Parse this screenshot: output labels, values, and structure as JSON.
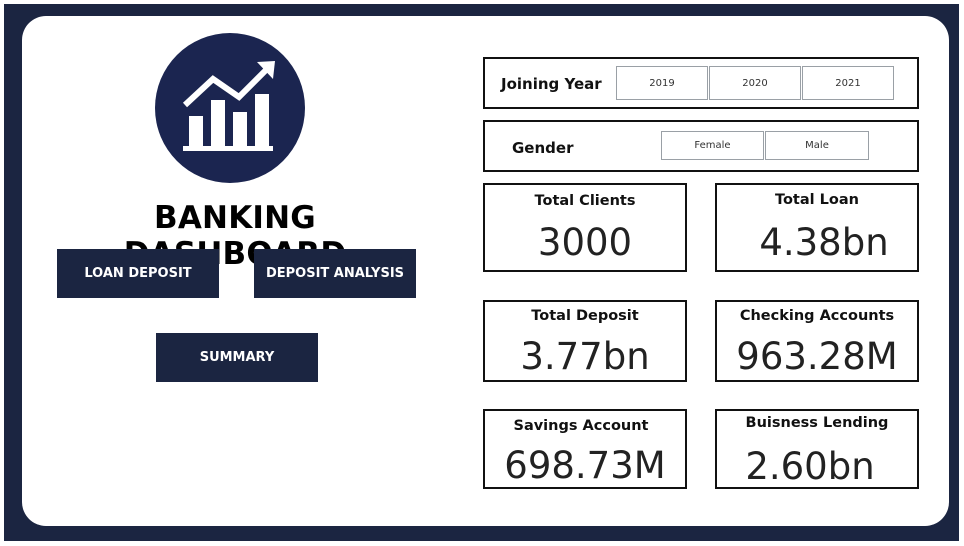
{
  "dashboard": {
    "title": "BANKING DASHBOARD",
    "logo_icon": "growth-chart-icon",
    "colors": {
      "navy": "#1b2541",
      "logo": "#1b2550"
    },
    "nav": {
      "loan_deposit": "LOAN DEPOSIT",
      "deposit_analysis": "DEPOSIT ANALYSIS",
      "summary": "SUMMARY"
    }
  },
  "filters": {
    "joining_year": {
      "label": "Joining Year",
      "options": [
        "2019",
        "2020",
        "2021"
      ]
    },
    "gender": {
      "label": "Gender",
      "options": [
        "Female",
        "Male"
      ]
    }
  },
  "kpis": [
    {
      "label": "Total Clients",
      "value": "3000"
    },
    {
      "label": "Total Loan",
      "value": "4.38bn"
    },
    {
      "label": "Total Deposit",
      "value": "3.77bn"
    },
    {
      "label": "Checking Accounts",
      "value": "963.28M"
    },
    {
      "label": "Savings Account",
      "value": "698.73M"
    },
    {
      "label": "Buisness Lending",
      "value": "2.60bn"
    }
  ]
}
